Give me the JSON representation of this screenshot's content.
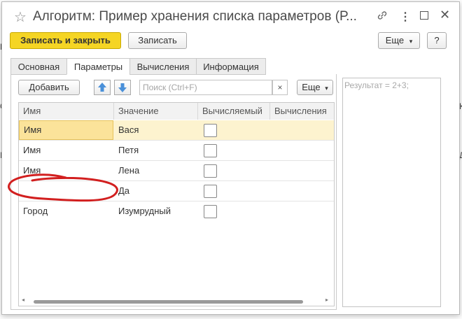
{
  "window": {
    "title": "Алгоритм: Пример хранения списка параметров (Р...",
    "icons": [
      "star-icon",
      "link-icon",
      "more-vert-icon",
      "maximize-icon",
      "close-icon"
    ]
  },
  "toolbar": {
    "save_close": "Записать и закрыть",
    "save": "Записать",
    "more": "Еще",
    "help": "?"
  },
  "tabs": [
    "Основная",
    "Параметры",
    "Вычисления",
    "Информация"
  ],
  "params_toolbar": {
    "add": "Добавить",
    "search_placeholder": "Поиск (Ctrl+F)",
    "clear": "×",
    "more": "Еще"
  },
  "table": {
    "columns": [
      "Имя",
      "Значение",
      "Вычисляемый",
      "Вычисления"
    ],
    "rows": [
      {
        "name": "Имя",
        "value": "Вася",
        "computed": false
      },
      {
        "name": "Имя",
        "value": "Петя",
        "computed": false
      },
      {
        "name": "Имя",
        "value": "Лена",
        "computed": false
      },
      {
        "name": "",
        "value": "Да",
        "computed": false
      },
      {
        "name": "Город",
        "value": "Изумрудный",
        "computed": false
      }
    ]
  },
  "result": {
    "placeholder": "Результат = 2+3;"
  },
  "colors": {
    "primary": "#f5d524",
    "selected_row": "#fdf3cf",
    "annotation": "#d21f1f"
  }
}
